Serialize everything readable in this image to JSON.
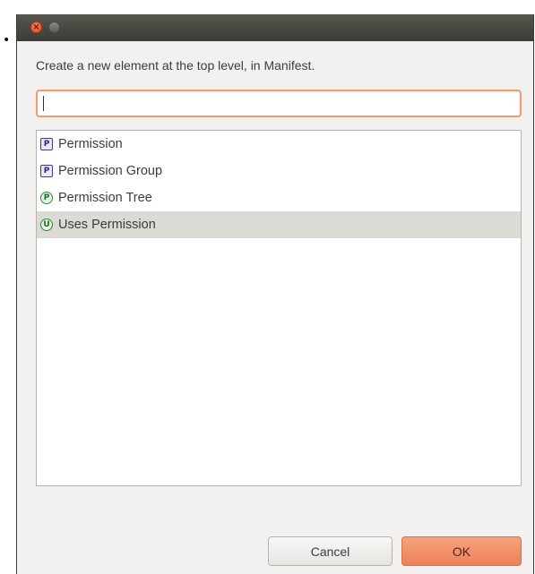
{
  "window": {
    "prompt": "Create a new element at the top level, in Manifest.",
    "input_value": ""
  },
  "list": {
    "items": [
      {
        "icon": "P",
        "label": "Permission",
        "icon_shape": "square",
        "selected": false
      },
      {
        "icon": "P",
        "label": "Permission Group",
        "icon_shape": "square",
        "selected": false
      },
      {
        "icon": "P",
        "label": "Permission Tree",
        "icon_shape": "circle",
        "selected": false
      },
      {
        "icon": "U",
        "label": "Uses Permission",
        "icon_shape": "circle",
        "selected": true
      }
    ]
  },
  "buttons": {
    "cancel": "Cancel",
    "ok": "OK"
  },
  "colors": {
    "titlebar": "#3c3b37",
    "accent": "#ed8159",
    "selection": "#dcdad5"
  },
  "icons": {
    "close": "close-icon",
    "minimize": "minimize-icon"
  }
}
